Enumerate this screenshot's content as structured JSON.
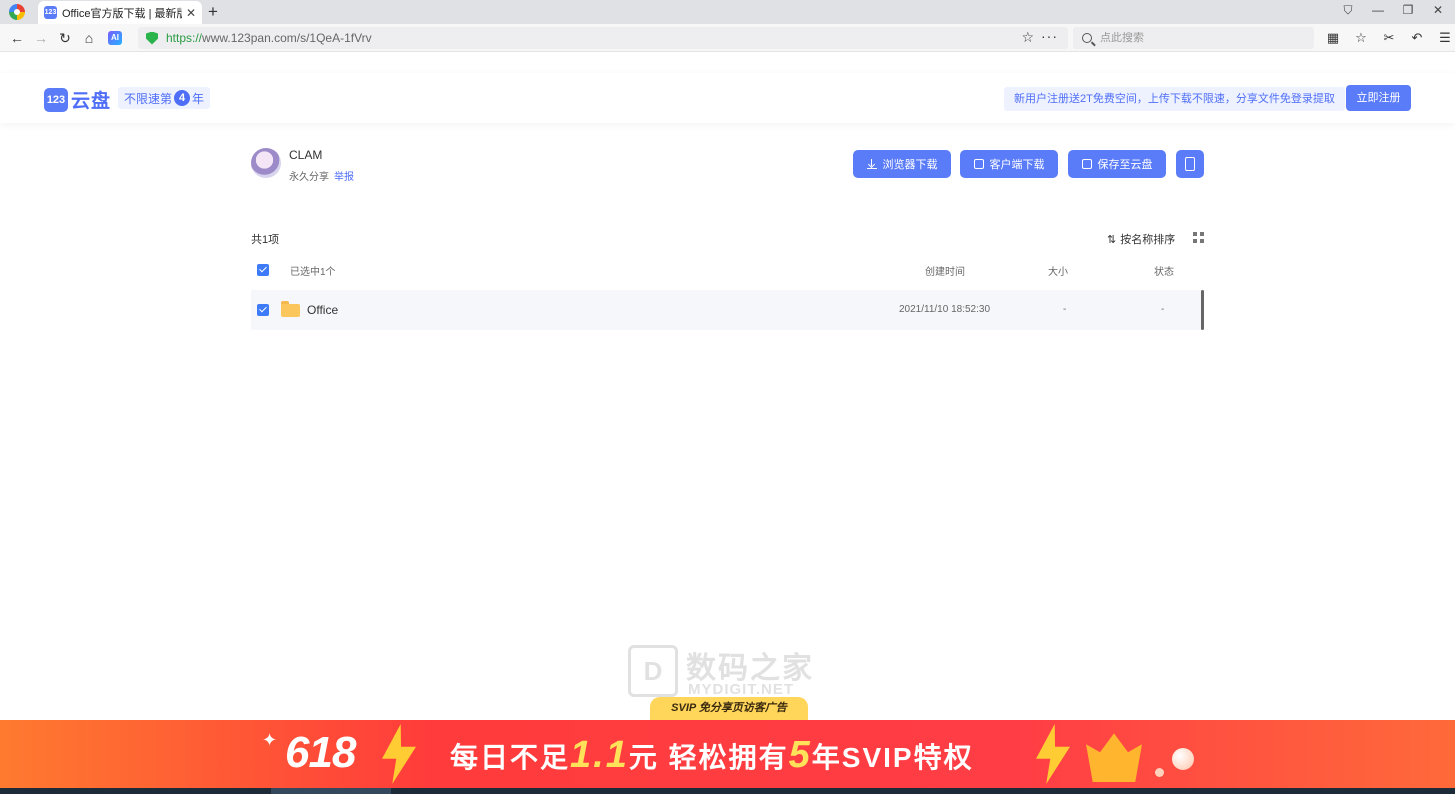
{
  "browser": {
    "tab_title": "Office官方版下载 | 最新版下载",
    "tab_favicon_text": "123",
    "url_scheme": "https://",
    "url_rest": "www.123pan.com/s/1QeA-1fVrv",
    "search_placeholder": "点此搜索",
    "ai_label": "AI",
    "icons": [
      "back-icon",
      "forward-icon",
      "reload-icon",
      "home-icon",
      "star-icon",
      "more-icon",
      "search-icon"
    ]
  },
  "header": {
    "logo_mark": "123",
    "logo_text": "云盘",
    "slogan_prefix": "不限速第",
    "slogan_num": "4",
    "slogan_suffix": "年",
    "promo": "新用户注册送2T免费空间，上传下载不限速，分享文件免登录提取",
    "register_label": "立即注册",
    "accent_color": "#5b7cf9"
  },
  "share": {
    "owner": "CLAM",
    "term": "永久分享",
    "report": "举报",
    "buttons": {
      "browser_download": "浏览器下载",
      "client_download": "客户端下载",
      "save_to_cloud": "保存至云盘"
    }
  },
  "list": {
    "count": "共1项",
    "sort_label": "按名称排序",
    "selected": "已选中1个",
    "col_created": "创建时间",
    "col_size": "大小",
    "col_status": "状态",
    "rows": [
      {
        "name": "Office",
        "created": "2021/11/10 18:52:30",
        "size": "-",
        "status": "-"
      }
    ]
  },
  "watermark": {
    "cn": "数码之家",
    "en": "MYDIGIT.NET",
    "mark": "D"
  },
  "ad": {
    "tag": "SVIP 免分享页访客广告",
    "promo_618": "618",
    "line_a": "每日不足",
    "price": "1.1",
    "line_b": "元  轻松拥有",
    "years": "5",
    "line_c": "年SVIP特权"
  }
}
